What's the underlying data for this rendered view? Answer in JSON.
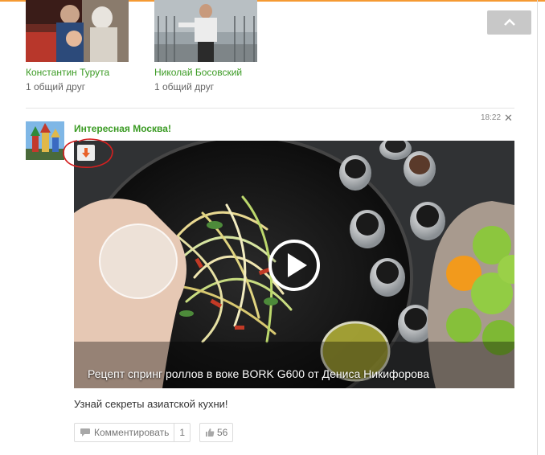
{
  "friends": [
    {
      "name": "Константин Турута",
      "mutual": "1 общий друг"
    },
    {
      "name": "Николай Босовский",
      "mutual": "1 общий друг"
    }
  ],
  "post": {
    "group_name": "Интересная Москва!",
    "time": "18:22",
    "close_symbol": "✕",
    "video": {
      "title": "Рецепт спринг роллов в воке BORK G600 от Дениса Никифорова"
    },
    "text": "Узнай секреты азиатской кухни!",
    "actions": {
      "comment_label": "Комментировать",
      "comment_count": "1",
      "like_count": "56"
    }
  },
  "colors": {
    "accent_orange": "#f59a33",
    "link_green": "#3b9b24",
    "annotation_red": "#d42020"
  },
  "icons": [
    "chevron-up-icon",
    "close-icon",
    "download-arrow-icon",
    "play-icon",
    "comment-icon",
    "thumbs-up-icon"
  ]
}
